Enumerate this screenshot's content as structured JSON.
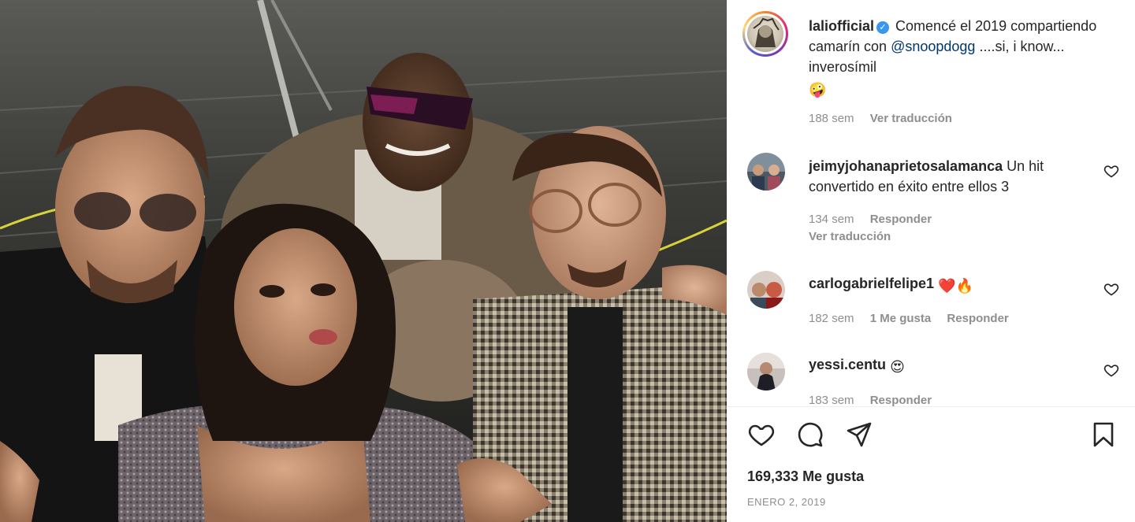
{
  "post": {
    "author": "laliofficial",
    "verified": true,
    "caption_prefix": "Comencé el 2019 compartiendo camarín con",
    "caption_mention": "@snoopdogg",
    "caption_suffix": "....si, i know... inverosímil",
    "caption_emoji": "🤪",
    "time": "188 sem",
    "translate": "Ver traducción"
  },
  "comments": [
    {
      "user": "jeimyjohanaprietosalamanca",
      "text": "Un hit convertido en éxito entre ellos 3",
      "time": "134 sem",
      "reply": "Responder",
      "translate": "Ver traducción"
    },
    {
      "user": "carlogabrielfelipe1",
      "text": "❤️🔥",
      "time": "182 sem",
      "likes": "1 Me gusta",
      "reply": "Responder"
    },
    {
      "user": "yessi.centu",
      "text": "😍",
      "time": "183 sem",
      "reply": "Responder"
    }
  ],
  "footer": {
    "likes": "169,333 Me gusta",
    "date": "ENERO 2, 2019"
  },
  "icons": {
    "like": "heart-icon",
    "comment": "comment-icon",
    "share": "share-icon",
    "save": "bookmark-icon"
  },
  "colors": {
    "mention": "#00376b",
    "verified": "#3897f0",
    "meta": "#8e8e8e"
  }
}
